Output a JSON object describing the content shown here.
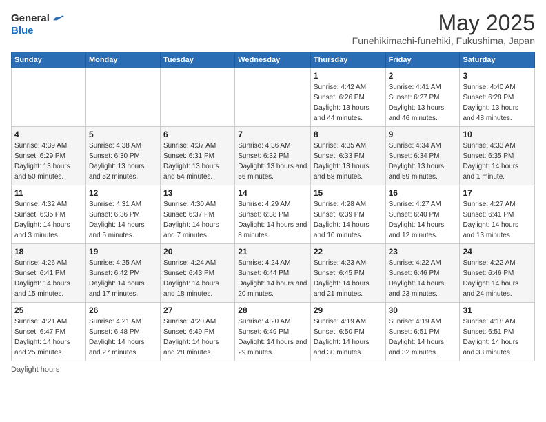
{
  "header": {
    "logo_general": "General",
    "logo_blue": "Blue",
    "title": "May 2025",
    "subtitle": "Funehikimachi-funehiki, Fukushima, Japan"
  },
  "weekdays": [
    "Sunday",
    "Monday",
    "Tuesday",
    "Wednesday",
    "Thursday",
    "Friday",
    "Saturday"
  ],
  "weeks": [
    [
      {
        "day": "",
        "sunrise": "",
        "sunset": "",
        "daylight": ""
      },
      {
        "day": "",
        "sunrise": "",
        "sunset": "",
        "daylight": ""
      },
      {
        "day": "",
        "sunrise": "",
        "sunset": "",
        "daylight": ""
      },
      {
        "day": "",
        "sunrise": "",
        "sunset": "",
        "daylight": ""
      },
      {
        "day": "1",
        "sunrise": "Sunrise: 4:42 AM",
        "sunset": "Sunset: 6:26 PM",
        "daylight": "Daylight: 13 hours and 44 minutes."
      },
      {
        "day": "2",
        "sunrise": "Sunrise: 4:41 AM",
        "sunset": "Sunset: 6:27 PM",
        "daylight": "Daylight: 13 hours and 46 minutes."
      },
      {
        "day": "3",
        "sunrise": "Sunrise: 4:40 AM",
        "sunset": "Sunset: 6:28 PM",
        "daylight": "Daylight: 13 hours and 48 minutes."
      }
    ],
    [
      {
        "day": "4",
        "sunrise": "Sunrise: 4:39 AM",
        "sunset": "Sunset: 6:29 PM",
        "daylight": "Daylight: 13 hours and 50 minutes."
      },
      {
        "day": "5",
        "sunrise": "Sunrise: 4:38 AM",
        "sunset": "Sunset: 6:30 PM",
        "daylight": "Daylight: 13 hours and 52 minutes."
      },
      {
        "day": "6",
        "sunrise": "Sunrise: 4:37 AM",
        "sunset": "Sunset: 6:31 PM",
        "daylight": "Daylight: 13 hours and 54 minutes."
      },
      {
        "day": "7",
        "sunrise": "Sunrise: 4:36 AM",
        "sunset": "Sunset: 6:32 PM",
        "daylight": "Daylight: 13 hours and 56 minutes."
      },
      {
        "day": "8",
        "sunrise": "Sunrise: 4:35 AM",
        "sunset": "Sunset: 6:33 PM",
        "daylight": "Daylight: 13 hours and 58 minutes."
      },
      {
        "day": "9",
        "sunrise": "Sunrise: 4:34 AM",
        "sunset": "Sunset: 6:34 PM",
        "daylight": "Daylight: 13 hours and 59 minutes."
      },
      {
        "day": "10",
        "sunrise": "Sunrise: 4:33 AM",
        "sunset": "Sunset: 6:35 PM",
        "daylight": "Daylight: 14 hours and 1 minute."
      }
    ],
    [
      {
        "day": "11",
        "sunrise": "Sunrise: 4:32 AM",
        "sunset": "Sunset: 6:35 PM",
        "daylight": "Daylight: 14 hours and 3 minutes."
      },
      {
        "day": "12",
        "sunrise": "Sunrise: 4:31 AM",
        "sunset": "Sunset: 6:36 PM",
        "daylight": "Daylight: 14 hours and 5 minutes."
      },
      {
        "day": "13",
        "sunrise": "Sunrise: 4:30 AM",
        "sunset": "Sunset: 6:37 PM",
        "daylight": "Daylight: 14 hours and 7 minutes."
      },
      {
        "day": "14",
        "sunrise": "Sunrise: 4:29 AM",
        "sunset": "Sunset: 6:38 PM",
        "daylight": "Daylight: 14 hours and 8 minutes."
      },
      {
        "day": "15",
        "sunrise": "Sunrise: 4:28 AM",
        "sunset": "Sunset: 6:39 PM",
        "daylight": "Daylight: 14 hours and 10 minutes."
      },
      {
        "day": "16",
        "sunrise": "Sunrise: 4:27 AM",
        "sunset": "Sunset: 6:40 PM",
        "daylight": "Daylight: 14 hours and 12 minutes."
      },
      {
        "day": "17",
        "sunrise": "Sunrise: 4:27 AM",
        "sunset": "Sunset: 6:41 PM",
        "daylight": "Daylight: 14 hours and 13 minutes."
      }
    ],
    [
      {
        "day": "18",
        "sunrise": "Sunrise: 4:26 AM",
        "sunset": "Sunset: 6:41 PM",
        "daylight": "Daylight: 14 hours and 15 minutes."
      },
      {
        "day": "19",
        "sunrise": "Sunrise: 4:25 AM",
        "sunset": "Sunset: 6:42 PM",
        "daylight": "Daylight: 14 hours and 17 minutes."
      },
      {
        "day": "20",
        "sunrise": "Sunrise: 4:24 AM",
        "sunset": "Sunset: 6:43 PM",
        "daylight": "Daylight: 14 hours and 18 minutes."
      },
      {
        "day": "21",
        "sunrise": "Sunrise: 4:24 AM",
        "sunset": "Sunset: 6:44 PM",
        "daylight": "Daylight: 14 hours and 20 minutes."
      },
      {
        "day": "22",
        "sunrise": "Sunrise: 4:23 AM",
        "sunset": "Sunset: 6:45 PM",
        "daylight": "Daylight: 14 hours and 21 minutes."
      },
      {
        "day": "23",
        "sunrise": "Sunrise: 4:22 AM",
        "sunset": "Sunset: 6:46 PM",
        "daylight": "Daylight: 14 hours and 23 minutes."
      },
      {
        "day": "24",
        "sunrise": "Sunrise: 4:22 AM",
        "sunset": "Sunset: 6:46 PM",
        "daylight": "Daylight: 14 hours and 24 minutes."
      }
    ],
    [
      {
        "day": "25",
        "sunrise": "Sunrise: 4:21 AM",
        "sunset": "Sunset: 6:47 PM",
        "daylight": "Daylight: 14 hours and 25 minutes."
      },
      {
        "day": "26",
        "sunrise": "Sunrise: 4:21 AM",
        "sunset": "Sunset: 6:48 PM",
        "daylight": "Daylight: 14 hours and 27 minutes."
      },
      {
        "day": "27",
        "sunrise": "Sunrise: 4:20 AM",
        "sunset": "Sunset: 6:49 PM",
        "daylight": "Daylight: 14 hours and 28 minutes."
      },
      {
        "day": "28",
        "sunrise": "Sunrise: 4:20 AM",
        "sunset": "Sunset: 6:49 PM",
        "daylight": "Daylight: 14 hours and 29 minutes."
      },
      {
        "day": "29",
        "sunrise": "Sunrise: 4:19 AM",
        "sunset": "Sunset: 6:50 PM",
        "daylight": "Daylight: 14 hours and 30 minutes."
      },
      {
        "day": "30",
        "sunrise": "Sunrise: 4:19 AM",
        "sunset": "Sunset: 6:51 PM",
        "daylight": "Daylight: 14 hours and 32 minutes."
      },
      {
        "day": "31",
        "sunrise": "Sunrise: 4:18 AM",
        "sunset": "Sunset: 6:51 PM",
        "daylight": "Daylight: 14 hours and 33 minutes."
      }
    ]
  ],
  "footer": {
    "daylight_hours_label": "Daylight hours"
  }
}
